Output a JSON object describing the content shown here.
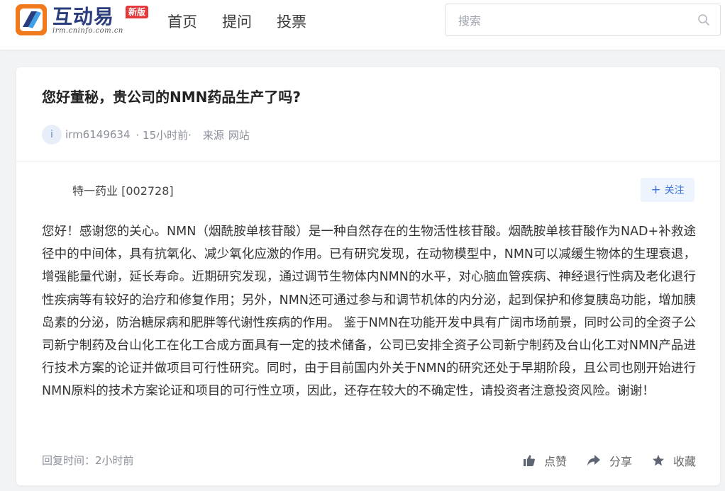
{
  "header": {
    "logo_text": "互动易",
    "logo_sub": "irm.cninfo.com.cn",
    "badge": "新版",
    "nav": [
      {
        "label": "首页"
      },
      {
        "label": "提问"
      },
      {
        "label": "投票"
      }
    ],
    "search_placeholder": "搜索",
    "search_icon": "search-icon"
  },
  "question": {
    "title": "您好董秘，贵公司的NMN药品生产了吗?",
    "avatar_letter": "i",
    "user": "irm6149634",
    "time": "· 15小时前·",
    "source_label": "来源",
    "source_value": "网站"
  },
  "answer": {
    "company": "特一药业 [002728]",
    "follow_label": "关注",
    "text": "您好！感谢您的关心。NMN（烟酰胺单核苷酸）是一种自然存在的生物活性核苷酸。烟酰胺单核苷酸作为NAD+补救途径中的中间体，具有抗氧化、减少氧化应激的作用。已有研究发现，在动物模型中，NMN可以减缓生物体的生理衰退，增强能量代谢，延长寿命。近期研究发现，通过调节生物体内NMN的水平，对心脑血管疾病、神经退行性病及老化退行性疾病等有较好的治疗和修复作用；另外，NMN还可通过参与和调节机体的内分泌，起到保护和修复胰岛功能，增加胰岛素的分泌，防治糖尿病和肥胖等代谢性疾病的作用。 鉴于NMN在功能开发中具有广阔市场前景，同时公司的全资子公司新宁制药及台山化工在化工合成方面具有一定的技术储备，公司已安排全资子公司新宁制药及台山化工对NMN产品进行技术方案的论证并做项目可行性研究。同时，由于目前国内外关于NMN的研究还处于早期阶段，且公司也刚开始进行NMN原料的技术方案论证和项目的可行性立项，因此，还存在较大的不确定性，请投资者注意投资风险。谢谢！",
    "reply_time": "回复时间：2小时前",
    "actions": [
      {
        "label": "点赞",
        "icon": "thumbs-up-icon"
      },
      {
        "label": "分享",
        "icon": "share-icon"
      },
      {
        "label": "收藏",
        "icon": "star-icon"
      }
    ]
  },
  "colors": {
    "accent": "#3a73d6",
    "badge": "#e4393c",
    "logo_orange": "#f07a1c",
    "logo_navy": "#2a3d7c"
  }
}
